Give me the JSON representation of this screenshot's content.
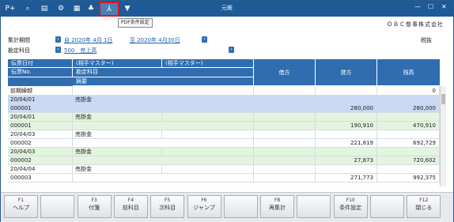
{
  "window": {
    "title": "元帳",
    "company": "ＯＢＣ慈事株式会社"
  },
  "toolbar": {
    "icons": [
      "person-plus-icon",
      "zoom-icon",
      "print-icon",
      "settings-icon",
      "data-icon",
      "chart-icon",
      "pdf-icon",
      "dropdown-icon"
    ],
    "tooltip": "PDF条件設定"
  },
  "controls": {
    "minimize": "—",
    "maximize": "☐",
    "close": "✕"
  },
  "filters": {
    "period_label": "集計期間",
    "period_from": "自 2020年 4月 1日",
    "period_to": "至 2020年 4月30日",
    "account_label": "勘定科目",
    "account_value": "500　売上高",
    "tax_mode": "税抜"
  },
  "table": {
    "headers": {
      "date": "伝票日付",
      "partner1": "(相手マスター)",
      "partner2": "(相手マスター)",
      "voucher": "伝票No.",
      "account": "勘定科目",
      "memo": "摘要",
      "credit": "借方",
      "debit": "貸方",
      "balance": "残高"
    },
    "carry_over": {
      "label": "前期繰越",
      "balance": "0"
    },
    "rows": [
      {
        "date": "20/04/01",
        "account": "売掛金",
        "voucher": "000001",
        "credit": "",
        "debit": "280,000",
        "balance": "280,000",
        "style": "blue"
      },
      {
        "date": "20/04/01",
        "account": "売掛金",
        "voucher": "000001",
        "credit": "",
        "debit": "190,910",
        "balance": "470,910",
        "style": "green"
      },
      {
        "date": "20/04/03",
        "account": "売掛金",
        "voucher": "000002",
        "credit": "",
        "debit": "221,819",
        "balance": "692,729",
        "style": "white"
      },
      {
        "date": "20/04/03",
        "account": "売掛金",
        "voucher": "000002",
        "credit": "",
        "debit": "27,873",
        "balance": "720,602",
        "style": "green"
      },
      {
        "date": "20/04/04",
        "account": "売掛金",
        "voucher": "000003",
        "credit": "",
        "debit": "271,773",
        "balance": "992,375",
        "style": "white"
      }
    ]
  },
  "fkeys": [
    {
      "key": "F1",
      "label": "ヘルプ"
    },
    {
      "key": "",
      "label": ""
    },
    {
      "key": "F3",
      "label": "付箋"
    },
    {
      "key": "F4",
      "label": "前科目"
    },
    {
      "key": "F5",
      "label": "次科目"
    },
    {
      "key": "F6",
      "label": "ジャンプ"
    },
    {
      "key": "",
      "label": ""
    },
    {
      "key": "F8",
      "label": "再集計"
    },
    {
      "key": "",
      "label": ""
    },
    {
      "key": "F10",
      "label": "条件設定"
    },
    {
      "key": "",
      "label": ""
    },
    {
      "key": "F12",
      "label": "閉じる"
    }
  ],
  "colors": {
    "header": "#2f6db0",
    "title": "#1d5a97",
    "row_blue": "#c9d8f3",
    "row_green": "#e3f4e0",
    "highlight": "#e0141f"
  }
}
